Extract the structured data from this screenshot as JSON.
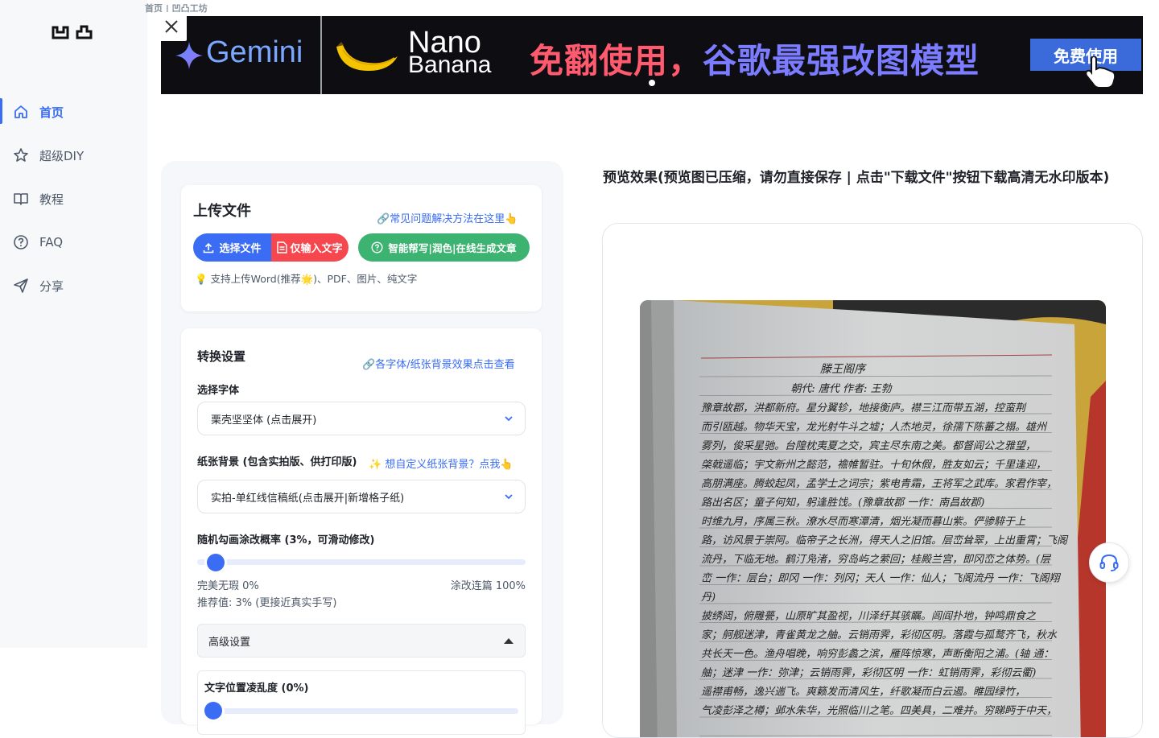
{
  "breadcrumb": "首页 | 凹凸工坊",
  "logo_icon": "app-logo-icon",
  "sidebar": {
    "items": [
      {
        "label": "首页",
        "icon": "home-icon",
        "active": true
      },
      {
        "label": "超级DIY",
        "icon": "star-icon",
        "active": false
      },
      {
        "label": "教程",
        "icon": "book-icon",
        "active": false
      },
      {
        "label": "FAQ",
        "icon": "help-circle-icon",
        "active": false
      },
      {
        "label": "分享",
        "icon": "send-icon",
        "active": false
      }
    ]
  },
  "banner": {
    "brand": "Gemini",
    "product_line1": "Nano",
    "product_line2": "Banana",
    "slogan_part1": "免翻使用，",
    "slogan_part2": "谷歌最强改图模型",
    "cta": "免费使用",
    "close_icon": "close-icon"
  },
  "upload": {
    "title": "上传文件",
    "faq_link": "常见问题解决方法在这里👆",
    "choose_file": "选择文件",
    "text_only": "仅输入文字",
    "ai_button": "智能帮写|润色|在线生成文章",
    "hint": "支持上传Word(推荐🌟)、PDF、图片、纯文字"
  },
  "settings": {
    "title": "转换设置",
    "effects_link": "各字体/纸张背景效果点击查看",
    "font_label": "选择字体",
    "font_value": "栗壳坚坚体 (点击展开)",
    "paper_label": "纸张背景 (包含实拍版、供打印版)",
    "paper_custom_link": "想自定义纸张背景？点我👆",
    "paper_value": "实拍-单红线信稿纸(点击展开|新增格子纸)",
    "scribble_label": "随机勾画涂改概率 (3%，可滑动修改)",
    "scribble_value_percent": 3,
    "scribble_min_label": "完美无瑕 0%",
    "scribble_max_label": "涂改连篇 100%",
    "recommend": "推荐值: 3% (更接近真实手写)",
    "advanced_label": "高级设置",
    "position_label": "文字位置凌乱度 (0%)",
    "position_value_percent": 0
  },
  "preview": {
    "title": "预览效果(预览图已压缩，请勿直接保存 | 点击\"下载文件\"按钮下载高清无水印版本)",
    "doc_title": "滕王阁序",
    "doc_author": "朝代: 唐代  作者: 王勃",
    "lines": [
      "豫章故郡，洪都新府。星分翼轸，地接衡庐。襟三江而带五湖，控蛮荆",
      "而引瓯越。物华天宝，龙光射牛斗之墟；人杰地灵，徐孺下陈蕃之榻。雄州",
      "雾列，俊采星驰。台隍枕夷夏之交，宾主尽东南之美。都督阎公之雅望，",
      "棨戟遥临；宇文新州之懿范，襜帷暂驻。十旬休假，胜友如云；千里逢迎，",
      "高朋满座。腾蛟起凤，孟学士之词宗；紫电青霜，王将军之武库。家君作宰，",
      "路出名区；童子何知，躬逢胜饯。(豫章故郡 一作：南昌故郡)",
      "时维九月，序属三秋。潦水尽而寒潭清，烟光凝而暮山紫。俨骖騑于上",
      "路，访风景于崇阿。临帝子之长洲，得天人之旧馆。层峦耸翠，上出重霄；飞阁",
      "流丹，下临无地。鹤汀凫渚，穷岛屿之萦回；桂殿兰宫，即冈峦之体势。(层",
      "峦 一作：层台；即冈 一作：列冈；天人 一作：仙人；飞阁流丹 一作：飞阁翔",
      "丹)",
      "披绣闼，俯雕甍，山原旷其盈视，川泽纡其骇瞩。闾阎扑地，钟鸣鼎食之",
      "家；舸舰迷津，青雀黄龙之舳。云销雨霁，彩彻区明。落霞与孤鹜齐飞，秋水",
      "共长天一色。渔舟唱晚，响穷彭蠡之滨，雁阵惊寒，声断衡阳之浦。(轴 通：",
      "舳；迷津 一作：弥津；云销雨霁，彩彻区明 一作：虹销雨霁，彩彻云衢)",
      "遥襟甫畅，逸兴遄飞。爽籁发而清风生，纤歌凝而白云遏。睢园绿竹，",
      "气凌彭泽之樽；邺水朱华，光照临川之笔。四美具，二难并。穷睇眄于中天，"
    ]
  },
  "support_icon": "headset-icon",
  "colors": {
    "accent": "#3a6cf4",
    "danger": "#f5474d",
    "success": "#3cb371"
  }
}
